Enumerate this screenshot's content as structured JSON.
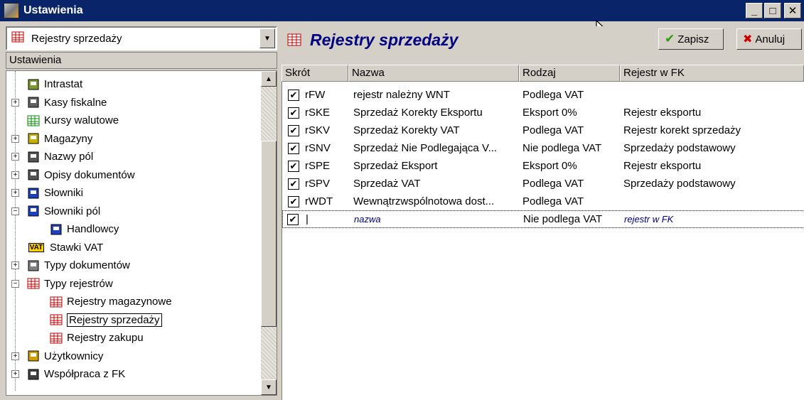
{
  "window": {
    "title": "Ustawienia",
    "buttons": {
      "minimize": "_",
      "maximize": "□",
      "close": "✕"
    }
  },
  "left_panel": {
    "combo_value": "Rejestry sprzedaży",
    "header": "Ustawienia",
    "tree": [
      {
        "label": "Intrastat",
        "icon": "pencil-icon",
        "expander": ""
      },
      {
        "label": "Kasy fiskalne",
        "icon": "cash-register-icon",
        "expander": "+"
      },
      {
        "label": "Kursy walutowe",
        "icon": "grid-green-icon",
        "expander": ""
      },
      {
        "label": "Magazyny",
        "icon": "box-icon",
        "expander": "+"
      },
      {
        "label": "Nazwy pól",
        "icon": "form-icon",
        "expander": "+"
      },
      {
        "label": "Opisy dokumentów",
        "icon": "form-icon",
        "expander": "+"
      },
      {
        "label": "Słowniki",
        "icon": "dictionary-icon",
        "expander": "+"
      },
      {
        "label": "Słowniki pól",
        "icon": "dictionary-icon",
        "expander": "−"
      },
      {
        "label": "Handlowcy",
        "icon": "book-icon",
        "expander": ""
      },
      {
        "label": "Stawki VAT",
        "icon": "vat-icon",
        "expander": ""
      },
      {
        "label": "Typy dokumentów",
        "icon": "documents-icon",
        "expander": "+"
      },
      {
        "label": "Typy rejestrów",
        "icon": "register-icon",
        "expander": "−"
      },
      {
        "label": "Rejestry magazynowe",
        "icon": "register-icon",
        "expander": ""
      },
      {
        "label": "Rejestry sprzedaży",
        "icon": "register-icon",
        "expander": ""
      },
      {
        "label": "Rejestry zakupu",
        "icon": "register-icon",
        "expander": ""
      },
      {
        "label": "Użytkownicy",
        "icon": "users-icon",
        "expander": "+"
      },
      {
        "label": "Współpraca z FK",
        "icon": "sync-icon",
        "expander": "+"
      }
    ]
  },
  "right_panel": {
    "title": "Rejestry sprzedaży",
    "save_label": "Zapisz",
    "cancel_label": "Anuluj",
    "columns": [
      "Skrót",
      "Nazwa",
      "Rodzaj",
      "Rejestr w FK"
    ],
    "rows": [
      {
        "checked": true,
        "skrot": "rFW",
        "nazwa": "rejestr należny WNT",
        "rodzaj": "Podlega VAT",
        "rejestr": ""
      },
      {
        "checked": true,
        "skrot": "rSKE",
        "nazwa": "Sprzedaż Korekty Eksportu",
        "rodzaj": "Eksport 0%",
        "rejestr": "Rejestr eksportu"
      },
      {
        "checked": true,
        "skrot": "rSKV",
        "nazwa": "Sprzedaż Korekty VAT",
        "rodzaj": "Podlega VAT",
        "rejestr": "Rejestr korekt sprzedaży"
      },
      {
        "checked": true,
        "skrot": "rSNV",
        "nazwa": "Sprzedaż Nie Podlegająca V...",
        "rodzaj": "Nie podlega VAT",
        "rejestr": "Sprzedaży podstawowy"
      },
      {
        "checked": true,
        "skrot": "rSPE",
        "nazwa": "Sprzedaż Eksport",
        "rodzaj": "Eksport 0%",
        "rejestr": "Rejestr eksportu"
      },
      {
        "checked": true,
        "skrot": "rSPV",
        "nazwa": "Sprzedaż VAT",
        "rodzaj": "Podlega VAT",
        "rejestr": "Sprzedaży podstawowy"
      },
      {
        "checked": true,
        "skrot": "rWDT",
        "nazwa": "Wewnątrzwspólnotowa dost...",
        "rodzaj": "Podlega VAT",
        "rejestr": ""
      }
    ],
    "new_row": {
      "checked": true,
      "skrot": "",
      "nazwa_placeholder": "nazwa",
      "rodzaj": "Nie podlega VAT",
      "rejestr_placeholder": "rejestr w FK"
    }
  }
}
